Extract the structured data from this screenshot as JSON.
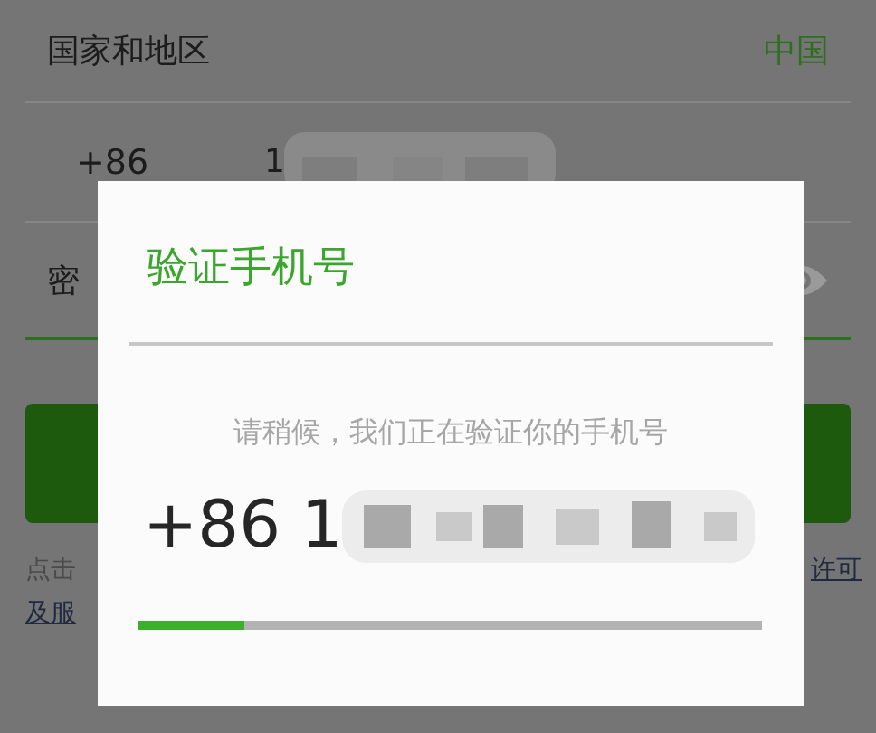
{
  "form": {
    "region_label": "国家和地区",
    "region_value": "中国",
    "country_code": "+86",
    "phone_prefix": "1",
    "password_label": "密",
    "password_visible": false,
    "agreement_start": "点击",
    "agreement_link_end": "许可",
    "agreement_link_start": "及服"
  },
  "dialog": {
    "title": "验证手机号",
    "message": "请稍候，我们正在验证你的手机号",
    "phone": "+86 1",
    "progress": {
      "level": 0.17
    }
  }
}
